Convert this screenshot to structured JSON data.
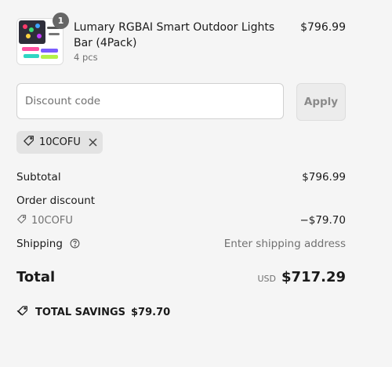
{
  "product": {
    "name": "Lumary RGBAI Smart Outdoor Lights Bar (4Pack)",
    "variant": "4 pcs",
    "price": "$796.99",
    "quantity": "1"
  },
  "discount": {
    "placeholder": "Discount code",
    "apply_label": "Apply",
    "applied_code": "10COFU"
  },
  "summary": {
    "subtotal_label": "Subtotal",
    "subtotal_value": "$796.99",
    "order_discount_label": "Order discount",
    "discount_code": "10COFU",
    "discount_value": "−$79.70",
    "shipping_label": "Shipping",
    "shipping_value": "Enter shipping address",
    "total_label": "Total",
    "currency": "USD",
    "total_value": "$717.29",
    "savings_label": "TOTAL SAVINGS",
    "savings_value": "$79.70"
  },
  "icons": {
    "tag": "tag-icon",
    "close": "close-icon",
    "help": "help-circle-icon",
    "savings": "savings-tag-icon"
  }
}
